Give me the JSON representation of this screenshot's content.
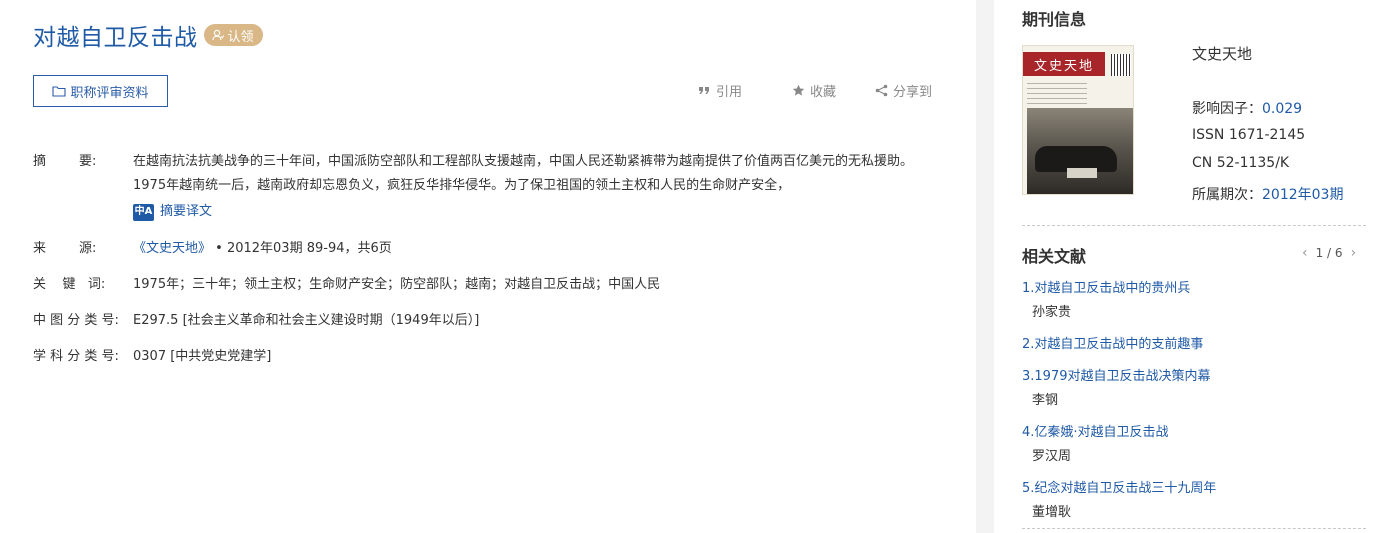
{
  "article": {
    "title": "对越自卫反击战",
    "claim_label": "认领",
    "eval_button": "职称评审资料",
    "actions": {
      "cite": "引用",
      "favorite": "收藏",
      "share": "分享到"
    }
  },
  "fields": {
    "abstract_label": "摘        要:",
    "abstract_text": "在越南抗法抗美战争的三十年间，中国派防空部队和工程部队支援越南，中国人民还勒紧裤带为越南提供了价值两百亿美元的无私援助。1975年越南统一后，越南政府却忘恩负义，疯狂反华排华侵华。为了保卫祖国的领土主权和人民的生命财产安全，",
    "translate_badge": "中A",
    "translate_label": "摘要译文",
    "source_label": "来        源:",
    "source_journal": "《文史天地》",
    "source_detail": " • 2012年03期 89-94，共6页",
    "keywords_label": "关    键   词:",
    "keywords": "1975年；三十年；领土主权；生命财产安全；防空部队；越南；对越自卫反击战；中国人民",
    "clc_label": "中 图 分 类 号:",
    "clc_value": "E297.5 [社会主义革命和社会主义建设时期（1949年以后）]",
    "subject_label": "学 科 分 类 号:",
    "subject_value": "0307 [中共党史党建学]"
  },
  "journal": {
    "heading": "期刊信息",
    "cover_title": "文史天地",
    "name": "文史天地",
    "impact_label": "影响因子：",
    "impact_value": "0.029",
    "issn": "ISSN 1671-2145",
    "cn": "CN 52-1135/K",
    "issue_label": "所属期次：",
    "issue_value": "2012年03期"
  },
  "related": {
    "heading": "相关文献",
    "pager": "1 / 6",
    "prev": "‹",
    "next": "›",
    "items": [
      {
        "title": "1.对越自卫反击战中的贵州兵",
        "author": "孙家贵"
      },
      {
        "title": "2.对越自卫反击战中的支前趣事",
        "author": ""
      },
      {
        "title": "3.1979对越自卫反击战决策内幕",
        "author": "李钢"
      },
      {
        "title": "4.亿秦娥·对越自卫反击战",
        "author": "罗汉周"
      },
      {
        "title": "5.纪念对越自卫反击战三十九周年",
        "author": "董增耿"
      }
    ]
  },
  "colors": {
    "accent": "#1f5aa6",
    "claim_badge": "#d9b786",
    "gutter": "#f3f3f3"
  }
}
